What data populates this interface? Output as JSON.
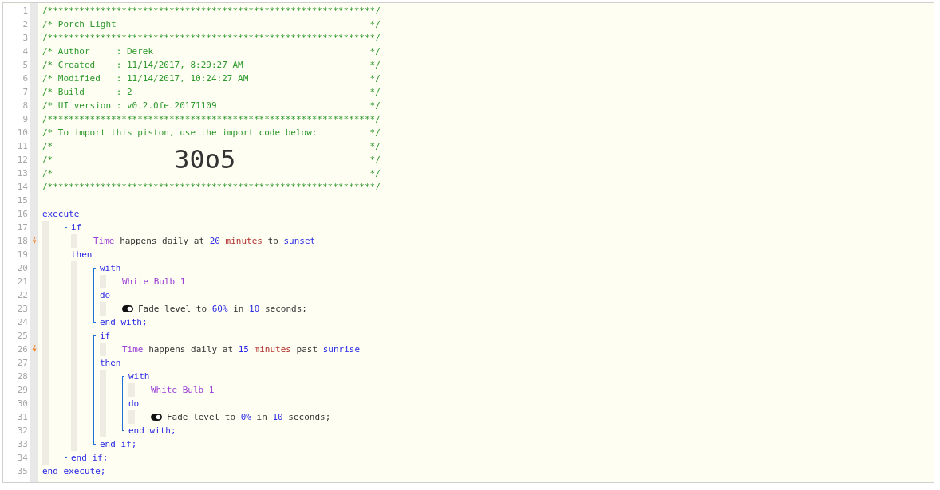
{
  "editor": {
    "lines": [
      {
        "number": "1",
        "kind": "comment",
        "text": "/**************************************************************/",
        "trigger": false
      },
      {
        "number": "2",
        "kind": "comment",
        "text": "/* Porch Light",
        "end": "*/",
        "trigger": false
      },
      {
        "number": "3",
        "kind": "comment",
        "text": "/**************************************************************/",
        "trigger": false
      },
      {
        "number": "4",
        "kind": "comment",
        "text": "/* Author     : Derek",
        "end": "*/",
        "trigger": false
      },
      {
        "number": "5",
        "kind": "comment",
        "text": "/* Created    : 11/14/2017, 8:29:27 AM",
        "end": "*/",
        "trigger": false
      },
      {
        "number": "6",
        "kind": "comment",
        "text": "/* Modified   : 11/14/2017, 10:24:27 AM",
        "end": "*/",
        "trigger": false
      },
      {
        "number": "7",
        "kind": "comment",
        "text": "/* Build      : 2",
        "end": "*/",
        "trigger": false
      },
      {
        "number": "8",
        "kind": "comment",
        "text": "/* UI version : v0.2.0fe.20171109",
        "end": "*/",
        "trigger": false
      },
      {
        "number": "9",
        "kind": "comment",
        "text": "/**************************************************************/",
        "trigger": false
      },
      {
        "number": "10",
        "kind": "comment",
        "text": "/* To import this piston, use the import code below:",
        "end": "*/",
        "trigger": false
      },
      {
        "number": "11",
        "kind": "comment",
        "text": "/*",
        "end": "*/",
        "trigger": false
      },
      {
        "number": "12",
        "kind": "comment",
        "text": "/*",
        "code": "30o5",
        "end": "*/",
        "trigger": false
      },
      {
        "number": "13",
        "kind": "comment",
        "text": "/*",
        "end": "*/",
        "trigger": false
      },
      {
        "number": "14",
        "kind": "comment",
        "text": "/**************************************************************/",
        "trigger": false
      },
      {
        "number": "15",
        "kind": "blank",
        "trigger": false
      },
      {
        "number": "16",
        "kind": "code",
        "trigger": false,
        "tokens": [
          {
            "text": "execute",
            "kind": "keyword"
          }
        ],
        "children": [
          {
            "kind": "group",
            "items": [
              {
                "number": "17",
                "kind": "code",
                "trigger": false,
                "tokens": [
                  {
                    "text": "if",
                    "kind": "keyword"
                  }
                ],
                "children": [
                  {
                    "number": "18",
                    "kind": "code",
                    "trigger": true,
                    "tokens": [
                      {
                        "text": "Time",
                        "kind": "device"
                      },
                      {
                        "text": "happens daily at",
                        "kind": "operator"
                      },
                      {
                        "text": "20",
                        "kind": "number"
                      },
                      {
                        "text": "minutes",
                        "kind": "unit"
                      },
                      {
                        "text": "to",
                        "kind": "operator"
                      },
                      {
                        "text": "sunset",
                        "kind": "number"
                      }
                    ]
                  }
                ]
              },
              {
                "number": "19",
                "kind": "code",
                "trigger": false,
                "tokens": [
                  {
                    "text": "then",
                    "kind": "keyword"
                  }
                ],
                "children": [
                  {
                    "kind": "group",
                    "items": [
                      {
                        "number": "20",
                        "kind": "code",
                        "trigger": false,
                        "tokens": [
                          {
                            "text": "with",
                            "kind": "keyword"
                          }
                        ],
                        "children": [
                          {
                            "number": "21",
                            "kind": "code",
                            "trigger": false,
                            "tokens": [
                              {
                                "text": "White Bulb 1",
                                "kind": "device"
                              }
                            ]
                          }
                        ]
                      },
                      {
                        "number": "22",
                        "kind": "code",
                        "trigger": false,
                        "tokens": [
                          {
                            "text": "do",
                            "kind": "keyword"
                          }
                        ],
                        "children": [
                          {
                            "number": "23",
                            "kind": "command",
                            "trigger": false,
                            "tokens": [
                              {
                                "text": "Fade level to",
                                "kind": "operator"
                              },
                              {
                                "text": "60%",
                                "kind": "number"
                              },
                              {
                                "text": "in",
                                "kind": "operator"
                              },
                              {
                                "text": "10",
                                "kind": "number"
                              },
                              {
                                "text": "seconds;",
                                "kind": "operator"
                              }
                            ]
                          }
                        ]
                      },
                      {
                        "number": "24",
                        "kind": "code",
                        "trigger": false,
                        "tokens": [
                          {
                            "text": "end with;",
                            "kind": "keyword"
                          }
                        ]
                      }
                    ]
                  },
                  {
                    "kind": "group",
                    "items": [
                      {
                        "number": "25",
                        "kind": "code",
                        "trigger": false,
                        "tokens": [
                          {
                            "text": "if",
                            "kind": "keyword"
                          }
                        ],
                        "children": [
                          {
                            "number": "26",
                            "kind": "code",
                            "trigger": true,
                            "tokens": [
                              {
                                "text": "Time",
                                "kind": "device"
                              },
                              {
                                "text": "happens daily at",
                                "kind": "operator"
                              },
                              {
                                "text": "15",
                                "kind": "number"
                              },
                              {
                                "text": "minutes",
                                "kind": "unit"
                              },
                              {
                                "text": "past",
                                "kind": "operator"
                              },
                              {
                                "text": "sunrise",
                                "kind": "number"
                              }
                            ]
                          }
                        ]
                      },
                      {
                        "number": "27",
                        "kind": "code",
                        "trigger": false,
                        "tokens": [
                          {
                            "text": "then",
                            "kind": "keyword"
                          }
                        ],
                        "children": [
                          {
                            "kind": "group",
                            "items": [
                              {
                                "number": "28",
                                "kind": "code",
                                "trigger": false,
                                "tokens": [
                                  {
                                    "text": "with",
                                    "kind": "keyword"
                                  }
                                ],
                                "children": [
                                  {
                                    "number": "29",
                                    "kind": "code",
                                    "trigger": false,
                                    "tokens": [
                                      {
                                        "text": "White Bulb 1",
                                        "kind": "device"
                                      }
                                    ]
                                  }
                                ]
                              },
                              {
                                "number": "30",
                                "kind": "code",
                                "trigger": false,
                                "tokens": [
                                  {
                                    "text": "do",
                                    "kind": "keyword"
                                  }
                                ],
                                "children": [
                                  {
                                    "number": "31",
                                    "kind": "command",
                                    "trigger": false,
                                    "tokens": [
                                      {
                                        "text": "Fade level to",
                                        "kind": "operator"
                                      },
                                      {
                                        "text": "0%",
                                        "kind": "number"
                                      },
                                      {
                                        "text": "in",
                                        "kind": "operator"
                                      },
                                      {
                                        "text": "10",
                                        "kind": "number"
                                      },
                                      {
                                        "text": "seconds;",
                                        "kind": "operator"
                                      }
                                    ]
                                  }
                                ]
                              },
                              {
                                "number": "32",
                                "kind": "code",
                                "trigger": false,
                                "tokens": [
                                  {
                                    "text": "end with;",
                                    "kind": "keyword"
                                  }
                                ]
                              }
                            ]
                          }
                        ]
                      },
                      {
                        "number": "33",
                        "kind": "code",
                        "trigger": false,
                        "tokens": [
                          {
                            "text": "end if;",
                            "kind": "keyword"
                          }
                        ]
                      }
                    ]
                  }
                ]
              },
              {
                "number": "34",
                "kind": "code",
                "trigger": false,
                "tokens": [
                  {
                    "text": "end if;",
                    "kind": "keyword"
                  }
                ]
              }
            ]
          }
        ]
      },
      {
        "number": "35",
        "kind": "code",
        "trigger": false,
        "tokens": [
          {
            "text": "end execute;",
            "kind": "keyword"
          }
        ]
      }
    ]
  }
}
